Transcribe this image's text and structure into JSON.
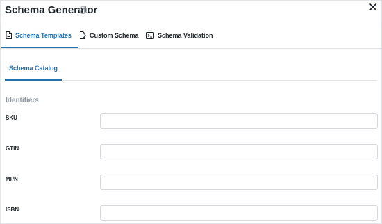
{
  "window": {
    "title": "Schema Generator",
    "help_icon": "question-circle-icon",
    "close_icon": "close-icon"
  },
  "tabs": [
    {
      "label": "Schema Templates",
      "icon": "document-icon",
      "active": true
    },
    {
      "label": "Custom Schema",
      "icon": "document-edit-icon",
      "active": false
    },
    {
      "label": "Schema Validation",
      "icon": "terminal-icon",
      "active": false
    }
  ],
  "subtabs": [
    {
      "label": "Schema Catalog",
      "active": true
    }
  ],
  "form": {
    "section_title": "Identifiers",
    "fields": [
      {
        "label": "SKU",
        "value": ""
      },
      {
        "label": "GTIN",
        "value": ""
      },
      {
        "label": "MPN",
        "value": ""
      },
      {
        "label": "ISBN",
        "value": ""
      }
    ]
  },
  "colors": {
    "accent": "#2171b1",
    "text": "#1d2327",
    "muted": "#8c949c",
    "border": "#e2e4e7"
  }
}
